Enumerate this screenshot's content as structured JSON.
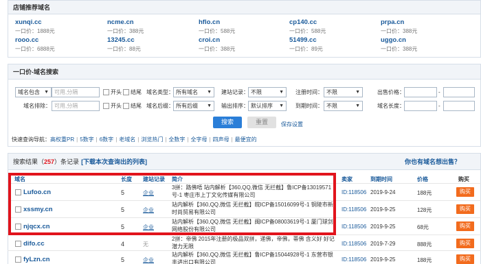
{
  "recommend": {
    "title": "店铺推荐域名",
    "price_prefix": "一口价：",
    "rows": [
      [
        {
          "domain": "xunqi.cc",
          "price": "1888元"
        },
        {
          "domain": "ncme.cn",
          "price": "388元"
        },
        {
          "domain": "hflo.cn",
          "price": "588元"
        },
        {
          "domain": "cp140.cc",
          "price": "588元"
        },
        {
          "domain": "prpa.cn",
          "price": "388元"
        }
      ],
      [
        {
          "domain": "rooo.cc",
          "price": "6888元"
        },
        {
          "domain": "13245.cc",
          "price": "88元"
        },
        {
          "domain": "croi.cn",
          "price": "388元"
        },
        {
          "domain": "51499.cc",
          "price": "89元"
        },
        {
          "domain": "uggo.cn",
          "price": "388元"
        }
      ]
    ]
  },
  "search": {
    "title": "一口价-域名搜索",
    "include_select": "域名包含",
    "include_placeholder": "可用,分隔",
    "exclude_label": "域名排除：",
    "exclude_placeholder": "可用,分隔",
    "start_label": "开头",
    "end_label": "结尾",
    "type_label": "域名类型：",
    "type_value": "所有域名",
    "suffix_label": "域名后缀：",
    "suffix_value": "所有后缀",
    "site_label": "建站记录：",
    "site_value": "不限",
    "order_label": "输出排序：",
    "order_value": "默认排序",
    "reg_label": "注册时间：",
    "reg_value": "不限",
    "expire_label": "到期时间：",
    "expire_value": "不限",
    "price_label": "出售价格：",
    "length_label": "域名长度：",
    "dash": "-",
    "search_btn": "搜索",
    "reset_btn": "重置",
    "save_link": "保存设置",
    "quick_label": "快速查询导航：",
    "quick_links": [
      "高权重PR",
      "5数字",
      "6数字",
      "老域名",
      "浏览热门",
      "全数字",
      "全字母",
      "四声母",
      "最便宜的"
    ]
  },
  "results": {
    "prefix": "搜索结果（",
    "count": "257",
    "suffix": "）条记录",
    "export_link": "[下载本次查询出的列表]",
    "help_link": "你也有域名想出售？",
    "headers": {
      "domain": "域名",
      "length": "长度",
      "site": "建站记录",
      "intro": "简介",
      "seller": "卖家",
      "expire": "到期时间",
      "price": "价格",
      "buy": "购买"
    },
    "rows": [
      {
        "domain": "Lufoo.cn",
        "length": "5",
        "site": "企业",
        "intro": "3拼：路佛唔 站内解析【360,QQ,微信 无拦截】鲁ICP备13019571号-1 枣庄市上丁文化传媒有限公司",
        "seller": "ID:118506",
        "expire": "2019-9-24",
        "price": "188元",
        "buy": "购买"
      },
      {
        "domain": "xssmy.cn",
        "length": "5",
        "site": "企业",
        "intro": "站内解析【360,QQ,微信 无拦截】皖ICP备15016099号-1 铜陵市新时尚贸易有限公司",
        "seller": "ID:118506",
        "expire": "2019-9-25",
        "price": "128元",
        "buy": "购买"
      },
      {
        "domain": "njqcx.cn",
        "length": "5",
        "site": "企业",
        "intro": "站内解析【360,QQ,微信 无拦截】闽ICP备08003619号-1 厦门球剑网络股份有限公司",
        "seller": "ID:118506",
        "expire": "2019-9-25",
        "price": "68元",
        "buy": "购买"
      },
      {
        "domain": "difo.cc",
        "length": "4",
        "site": "无",
        "intro": "2拼：帝佛 2015年注册的极品双拼，递佛，帝佛，蒂佛 含义好 好记 潜力无限",
        "seller": "ID:118506",
        "expire": "2019-7-29",
        "price": "888元",
        "buy": "购买"
      },
      {
        "domain": "fyLzn.cn",
        "length": "5",
        "site": "企业",
        "intro": "站内解析【360,QQ,微信 无拦截】鲁ICP备15044928号-1 东营市银丰进出口有限公司",
        "seller": "ID:118506",
        "expire": "2019-9-25",
        "price": "188元",
        "buy": "购买"
      }
    ]
  },
  "colors": {
    "link": "#1a5a9a",
    "highlight": "#e1141c",
    "buy": "#f26b1d",
    "search_btn": "#2a7ed8"
  }
}
